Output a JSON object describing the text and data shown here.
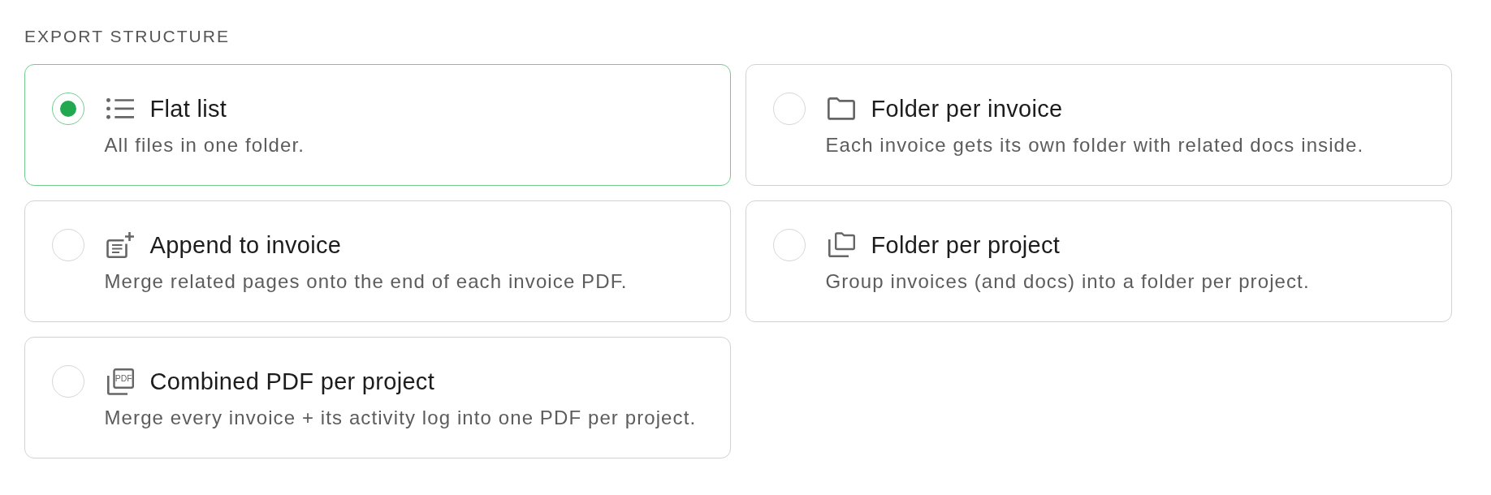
{
  "section": {
    "heading": "EXPORT STRUCTURE"
  },
  "options": [
    {
      "kind": "flat",
      "title": "Flat list",
      "description": "All files in one folder.",
      "selected": true
    },
    {
      "kind": "invoice",
      "title": "Folder per invoice",
      "description": "Each invoice gets its own folder with related docs inside.",
      "selected": false
    },
    {
      "kind": "append",
      "title": "Append to invoice",
      "description": "Merge related pages onto the end of each invoice PDF.",
      "selected": false
    },
    {
      "kind": "project",
      "title": "Folder per project",
      "description": "Group invoices (and docs) into a folder per project.",
      "selected": false
    },
    {
      "kind": "combined",
      "title": "Combined PDF per project",
      "description": "Merge every invoice + its activity log into one PDF per project.",
      "selected": false,
      "icon_label": "PDF"
    }
  ]
}
